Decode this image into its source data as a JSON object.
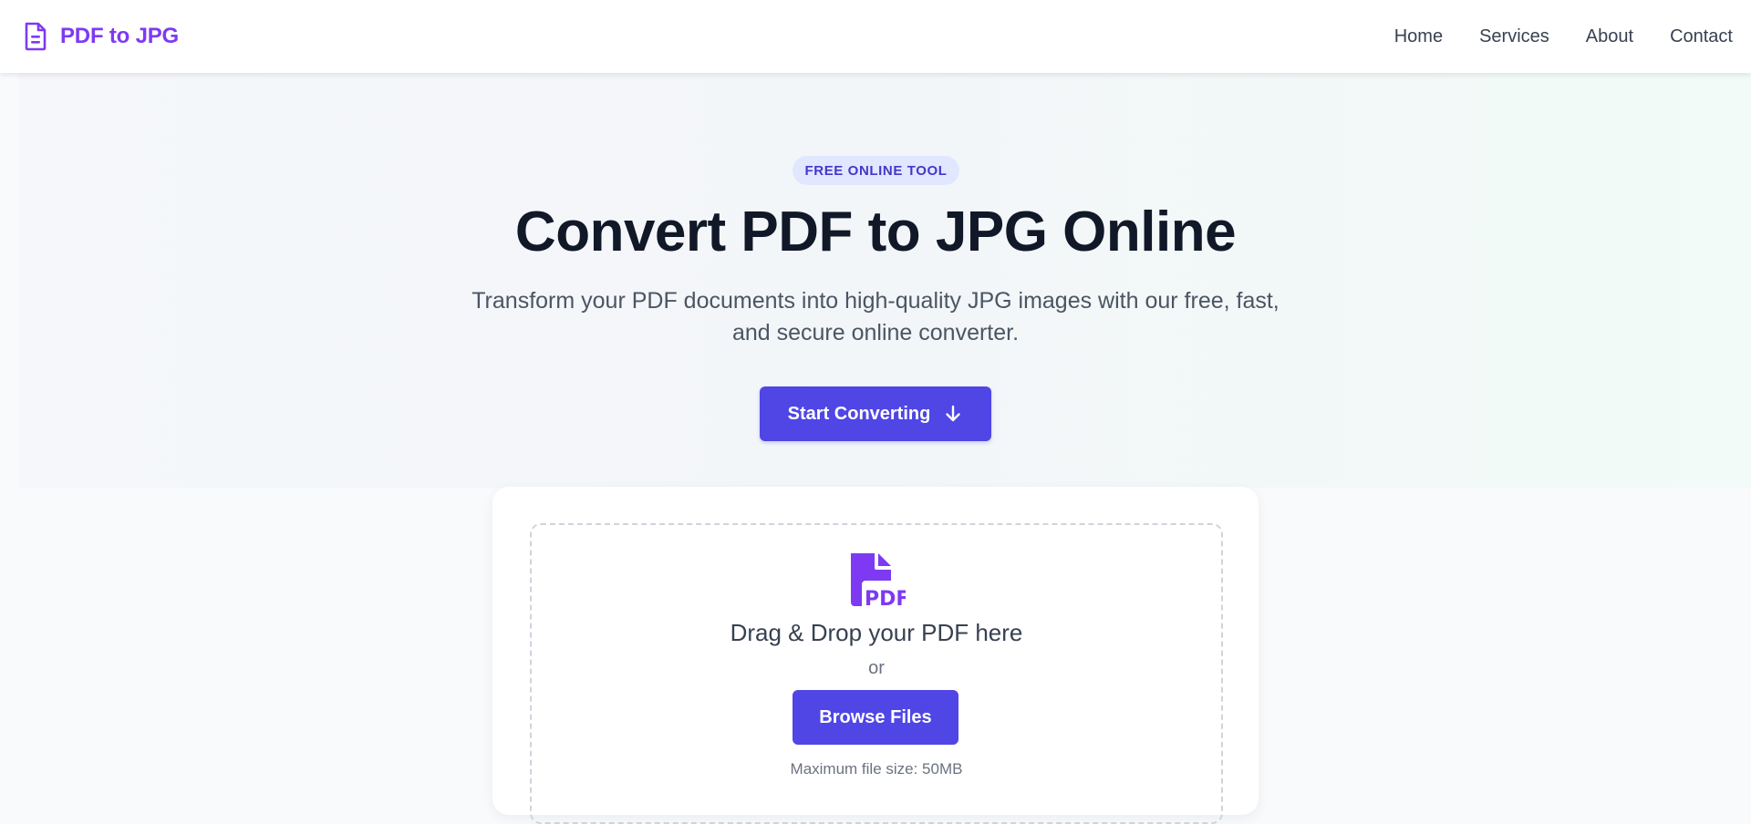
{
  "nav": {
    "brand": "PDF to JPG",
    "brand_icon": "document-icon",
    "links": [
      "Home",
      "Services",
      "About",
      "Contact"
    ]
  },
  "hero": {
    "badge": "FREE ONLINE TOOL",
    "title": "Convert PDF to JPG Online",
    "subtitle_line1": "Transform your PDF documents into high-quality JPG images with our free, fast,",
    "subtitle_line2": "and secure online converter.",
    "cta_label": "Start Converting",
    "cta_icon": "arrow-down-icon"
  },
  "upload": {
    "icon": "pdf-file-icon",
    "drop_title": "Drag & Drop your PDF here",
    "or_text": "or",
    "browse_label": "Browse Files",
    "max_size": "Maximum file size: 50MB"
  },
  "colors": {
    "brand": "#7e3af2",
    "primary": "#4f46e5",
    "badge_bg": "#e0e7ff",
    "badge_text": "#4338ca",
    "heading": "#111827"
  }
}
